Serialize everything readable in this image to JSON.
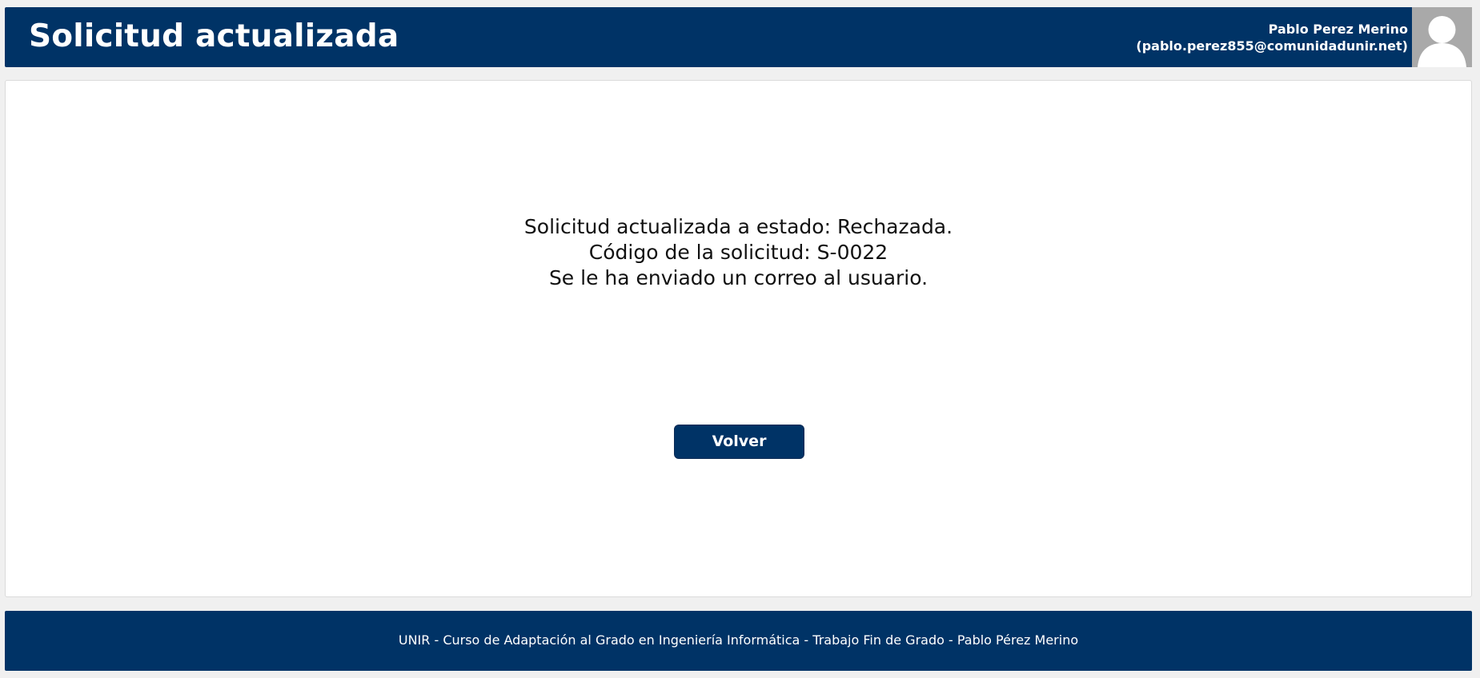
{
  "header": {
    "title": "Solicitud actualizada",
    "user_name": "Pablo Perez Merino",
    "user_email": "(pablo.perez855@comunidadunir.net)",
    "avatar_icon": "user-silhouette-icon"
  },
  "main": {
    "message_lines": [
      "Solicitud actualizada a estado: Rechazada.",
      "Código de la solicitud: S-0022",
      "Se le ha enviado un correo al usuario."
    ],
    "back_button_label": "Volver"
  },
  "footer": {
    "text": "UNIR - Curso de Adaptación al Grado en Ingeniería Informática - Trabajo Fin de Grado - Pablo Pérez Merino"
  },
  "colors": {
    "brand": "#003366",
    "background": "#f0f0f0",
    "panel": "#ffffff"
  }
}
